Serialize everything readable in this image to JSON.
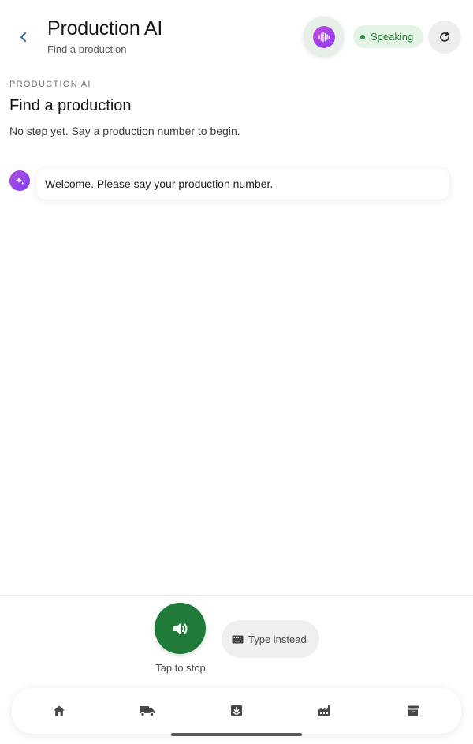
{
  "header": {
    "title": "Production AI",
    "subtitle": "Find a production",
    "status": "Speaking"
  },
  "step": {
    "section_label": "PRODUCTION AI",
    "title": "Find a production",
    "description": "No step yet. Say a production number to begin."
  },
  "messages": [
    {
      "role": "assistant",
      "text": "Welcome. Please say your production number."
    }
  ],
  "controls": {
    "stop_label": "Tap to stop",
    "type_label": "Type instead"
  },
  "nav": {
    "items": [
      {
        "icon": "home-icon"
      },
      {
        "icon": "truck-icon"
      },
      {
        "icon": "inbox-download-icon"
      },
      {
        "icon": "factory-icon"
      },
      {
        "icon": "archive-icon"
      }
    ]
  },
  "colors": {
    "accent_green": "#207a38",
    "status_bg": "#e3f4e4",
    "ai_purple": "#8a3cf0",
    "back_blue": "#2f5fb3"
  }
}
